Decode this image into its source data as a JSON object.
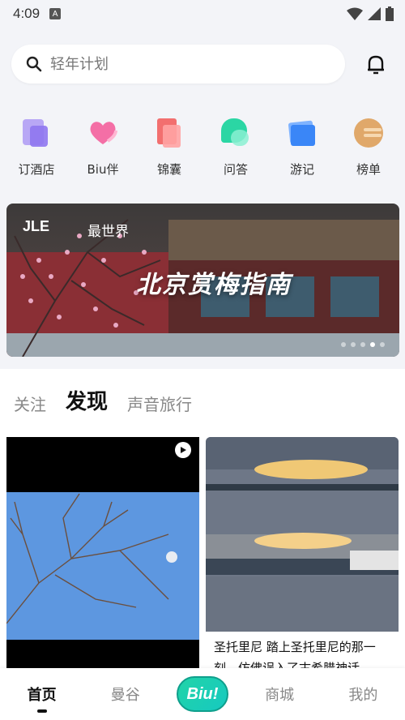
{
  "status": {
    "time": "4:09",
    "a_badge": "A"
  },
  "search": {
    "placeholder": "轻年计划"
  },
  "quick": [
    {
      "label": "订酒店",
      "icon": "hotel-icon"
    },
    {
      "label": "Biu伴",
      "icon": "heart-icon"
    },
    {
      "label": "锦囊",
      "icon": "bag-icon"
    },
    {
      "label": "问答",
      "icon": "chat-icon"
    },
    {
      "label": "游记",
      "icon": "notes-icon"
    },
    {
      "label": "榜单",
      "icon": "ranking-icon"
    }
  ],
  "banner": {
    "title": "北京赏梅指南",
    "logo": "JLE",
    "logo_sub": "最世界"
  },
  "tabs": [
    "关注",
    "发现",
    "声音旅行"
  ],
  "feed": {
    "right_caption": "圣托里尼 踏上圣托里尼的那一刻，仿佛误入了古希腊神话"
  },
  "nav": {
    "home": "首页",
    "mango": "曼谷",
    "biu": "Biu!",
    "mall": "商城",
    "mine": "我的"
  },
  "colors": {
    "accent": "#2ee0c5",
    "background": "#f3f4f8"
  }
}
